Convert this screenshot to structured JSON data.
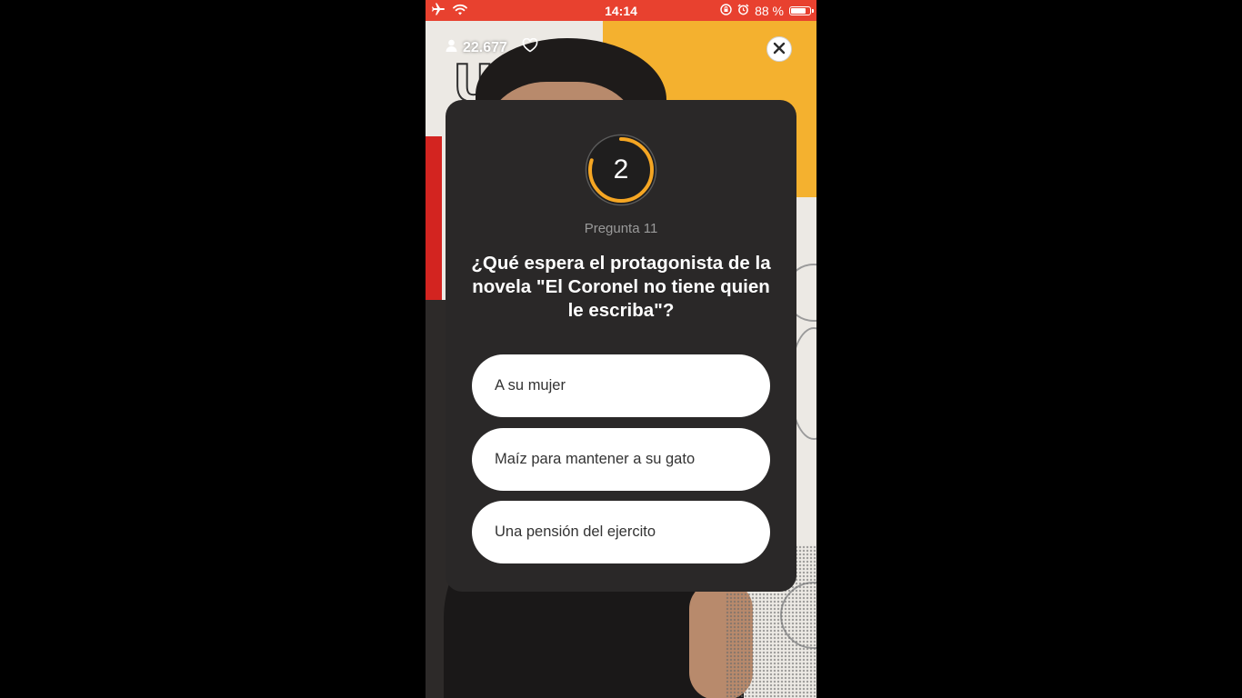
{
  "status_bar": {
    "time": "14:14",
    "battery_percent": "88 %",
    "battery_level": 0.88,
    "icons": [
      "airplane-icon",
      "wifi-icon",
      "orientation-lock-icon",
      "alarm-icon",
      "battery-icon"
    ]
  },
  "stream": {
    "viewer_count": "22.677"
  },
  "quiz": {
    "countdown": "2",
    "countdown_fraction": 0.8,
    "question_number": "Pregunta 11",
    "question": "¿Qué espera el protagonista de la novela \"El Coronel no tiene quien le escriba\"?",
    "answers": [
      {
        "label": "A su mujer"
      },
      {
        "label": "Maíz para mantener a su gato"
      },
      {
        "label": "Una pensión del ejercito"
      }
    ]
  },
  "colors": {
    "status_bar": "#e8412f",
    "card": "#2a2828",
    "timer_ring": "#f5a623",
    "answer_bg": "#ffffff"
  }
}
